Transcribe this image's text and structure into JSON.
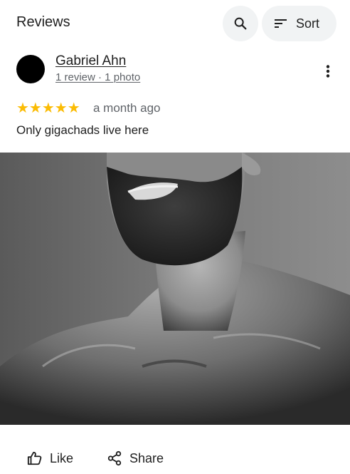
{
  "header": {
    "title": "Reviews",
    "search_icon": "search-icon",
    "sort_label": "Sort",
    "sort_icon": "sort-icon"
  },
  "review": {
    "author_name": "Gabriel Ahn",
    "author_meta": "1 review · 1 photo",
    "rating": 5,
    "rating_max": 5,
    "stars": "★★★★★",
    "date": "a month ago",
    "text": "Only gigachads live here",
    "more_icon": "more-vert-icon",
    "photo_icon": "review-photo"
  },
  "actions": {
    "like_label": "Like",
    "like_icon": "thumb-up-icon",
    "share_label": "Share",
    "share_icon": "share-icon"
  },
  "colors": {
    "star": "#fbbc04",
    "button_bg": "#f1f3f4",
    "text_primary": "#1f1f1f",
    "text_secondary": "#5f6368"
  }
}
